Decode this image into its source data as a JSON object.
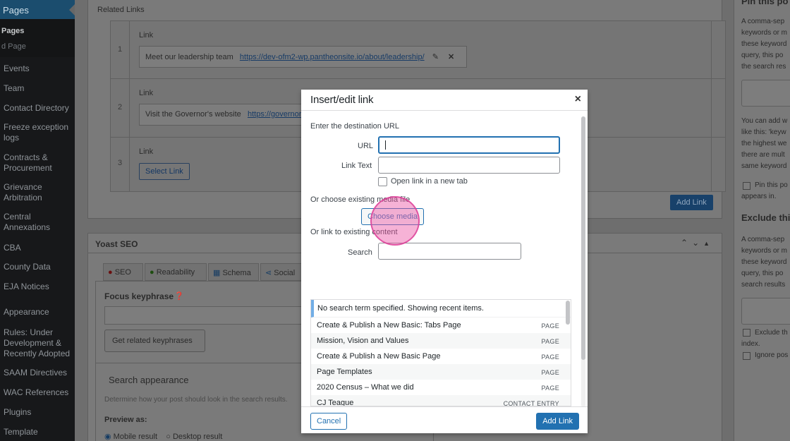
{
  "sidebar": {
    "active": "Pages",
    "submenu": [
      "Pages",
      "d Page"
    ],
    "items": [
      "Events",
      "Team",
      "Contact Directory",
      "Freeze exception logs",
      "Contracts & Procurement",
      "Grievance Arbitration",
      "Central Annexations",
      "CBA",
      "County Data",
      "EJA Notices",
      "Appearance",
      "Rules: Under Development & Recently Adopted",
      "SAAM Directives",
      "WAC References",
      "Plugins",
      "Template"
    ]
  },
  "related_links": {
    "title": "Related Links",
    "rows": [
      {
        "num": "1",
        "label": "Link",
        "text": "Meet our leadership team",
        "url": "https://dev-ofm2-wp.pantheonsite.io/about/leadership/"
      },
      {
        "num": "2",
        "label": "Link",
        "text": "Visit the Governor's website",
        "url": "https://governor.wa"
      },
      {
        "num": "3",
        "label": "Link",
        "select_label": "Select Link"
      }
    ],
    "add_link": "Add Link"
  },
  "yoast": {
    "title": "Yoast SEO",
    "tabs": [
      "SEO",
      "Readability",
      "Schema",
      "Social"
    ],
    "focus_label": "Focus keyphrase",
    "related_btn": "Get related keyphrases",
    "search_appearance": "Search appearance",
    "search_desc": "Determine how your post should look in the search results.",
    "preview_as": "Preview as:",
    "mobile": "Mobile result",
    "desktop": "Desktop result"
  },
  "right": {
    "pin_title": "Pin this po",
    "pin_text": [
      "A comma-sep",
      "keywords or m",
      "these keyword",
      "query, this po",
      "the search res"
    ],
    "pin_text2": [
      "You can add w",
      "like this: 'keyw",
      "the highest we",
      "there are mult",
      "same keyword"
    ],
    "pin_check": [
      "Pin this po",
      "appears in."
    ],
    "exclude_title": "Exclude thi",
    "exclude_text": [
      "A comma-sep",
      "keywords or m",
      "these keyword",
      "query, this po",
      "search results"
    ],
    "exclude_check": [
      "Exclude th",
      "index."
    ],
    "ignore": "Ignore pos"
  },
  "modal": {
    "title": "Insert/edit link",
    "close": "×",
    "dest_label": "Enter the destination URL",
    "url_label": "URL",
    "url_value": "",
    "text_label": "Link Text",
    "text_value": "",
    "new_tab": "Open link in a new tab",
    "media_label": "Or choose existing media file",
    "choose_media": "Choose media",
    "existing_label": "Or link to existing content",
    "search_label": "Search",
    "search_value": "",
    "notice": "No search term specified. Showing recent items.",
    "results": [
      {
        "title": "Create & Publish a New Basic: Tabs Page",
        "type": "PAGE"
      },
      {
        "title": "Mission, Vision and Values",
        "type": "PAGE"
      },
      {
        "title": "Create & Publish a New Basic Page",
        "type": "PAGE"
      },
      {
        "title": "Page Templates",
        "type": "PAGE"
      },
      {
        "title": "2020 Census – What we did",
        "type": "PAGE"
      },
      {
        "title": "CJ Teague",
        "type": "CONTACT ENTRY"
      }
    ],
    "cancel": "Cancel",
    "add_link": "Add Link"
  }
}
